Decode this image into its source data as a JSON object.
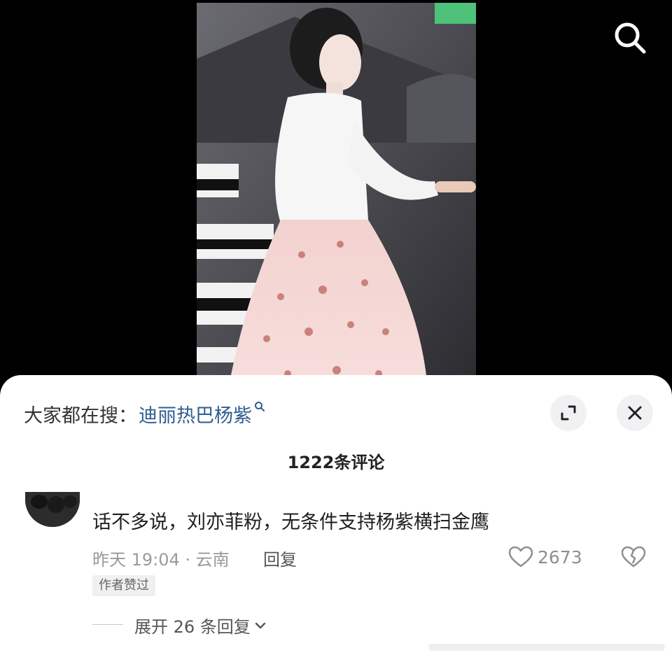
{
  "header": {
    "search_icon": "search-icon"
  },
  "hot_search": {
    "prefix": "大家都在搜：",
    "term": "迪丽热巴杨紫",
    "term_icon": "magnifier-small-icon"
  },
  "sheet_controls": {
    "expand_icon": "expand-icon",
    "close_icon": "close-icon"
  },
  "comments": {
    "count_label": "1222条评论",
    "items": [
      {
        "text": "话不多说，刘亦菲粉，无条件支持杨紫横扫金鹰",
        "meta": "昨天 19:04 · 云南",
        "reply_label": "回复",
        "likes": "2673",
        "badge": "作者赞过",
        "expand_label": "展开 26 条回复"
      }
    ]
  },
  "colors": {
    "accent_link": "#2f5d8f",
    "sheet_bg": "#ffffff",
    "muted_text": "#9a9a9a"
  }
}
